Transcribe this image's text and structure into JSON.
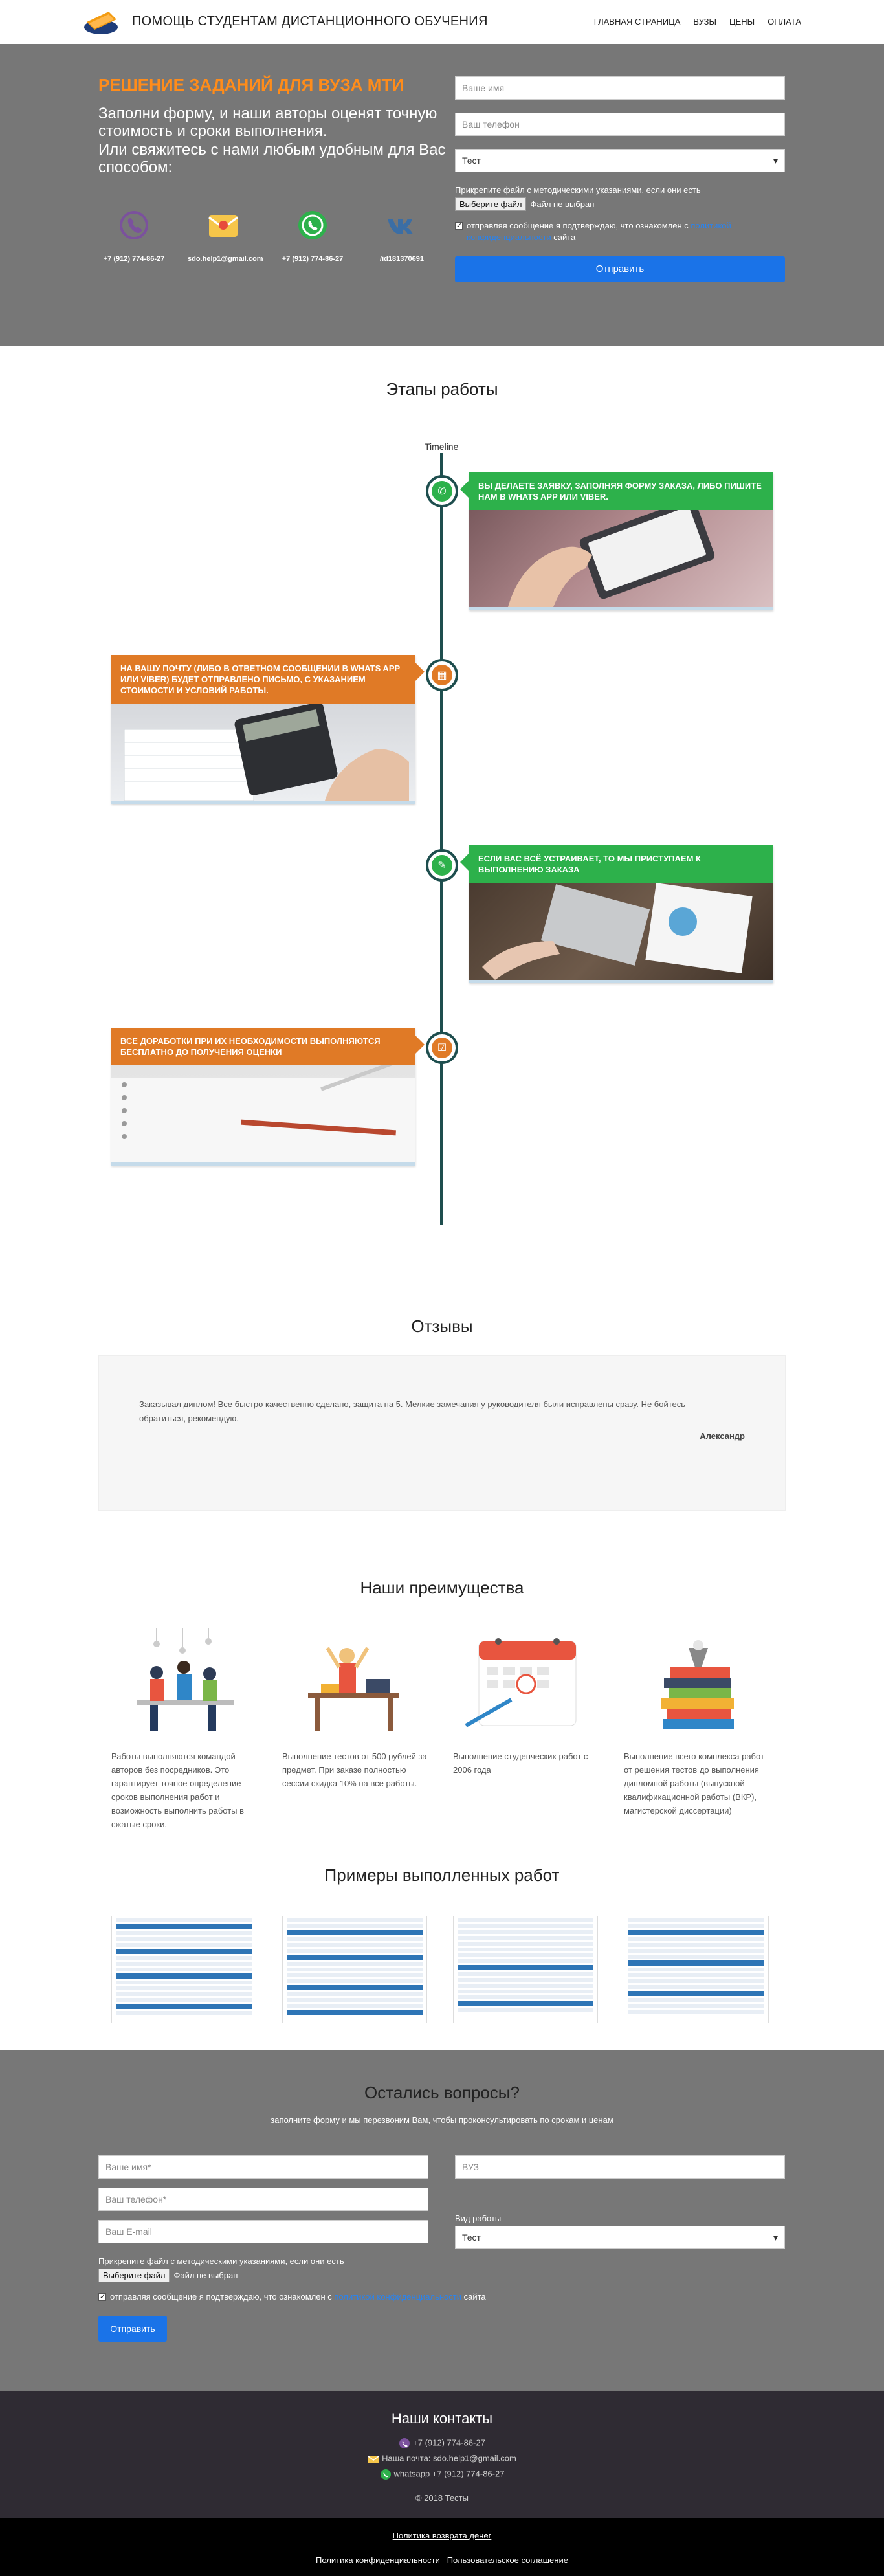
{
  "header": {
    "site_title": "ПОМОЩЬ СТУДЕНТАМ ДИСТАНЦИОННОГО ОБУЧЕНИЯ",
    "nav": [
      "ГЛАВНАЯ СТРАНИЦА",
      "ВУЗЫ",
      "ЦЕНЫ",
      "ОПЛАТА"
    ]
  },
  "hero": {
    "title": "РЕШЕНИЕ ЗАДАНИЙ ДЛЯ ВУЗА МТИ",
    "subtitle": "Заполни форму, и наши авторы оценят точную стоимость и сроки выполнения.",
    "subtitle2": "Или свяжитесь с нами любым удобным для Вас способом:",
    "contacts": [
      {
        "icon": "viber-icon",
        "label": "+7 (912) 774-86-27"
      },
      {
        "icon": "email-icon",
        "label": "sdo.help1@gmail.com"
      },
      {
        "icon": "whatsapp-icon",
        "label": "+7 (912) 774-86-27"
      },
      {
        "icon": "vk-icon",
        "label": "/id181370691"
      }
    ],
    "form": {
      "name_placeholder": "Ваше имя",
      "phone_placeholder": "Ваш телефон",
      "select_value": "Тест",
      "file_note": "Прикрепите файл с методическими указаниями, если они есть",
      "file_button": "Выберите файл",
      "file_status": "Файл не выбран",
      "agree_text": "отправляя сообщение я подтверждаю, что ознакомлен с",
      "agree_link": "политикой конфиденциальности",
      "agree_tail": "сайта",
      "submit": "Отправить"
    }
  },
  "stages": {
    "title": "Этапы работы",
    "timeline_label": "Timeline",
    "steps": [
      {
        "text": "ВЫ ДЕЛАЕТЕ ЗАЯВКУ, ЗАПОЛНЯЯ ФОРМУ ЗАКАЗА, ЛИБО ПИШИТЕ НАМ В WHATS APP ИЛИ VIBER.",
        "icon": "whatsapp-icon",
        "color": "#2db14b"
      },
      {
        "text": "НА ВАШУ ПОЧТУ (ЛИБО В ОТВЕТНОМ СООБЩЕНИИ В WHATS APP ИЛИ VIBER) БУДЕТ ОТПРАВЛЕНО ПИСЬМО, С УКАЗАНИЕМ СТОИМОСТИ И УСЛОВИЙ РАБОТЫ.",
        "icon": "calendar-icon",
        "color": "#e07a26"
      },
      {
        "text": "ЕСЛИ ВАС ВСЁ УСТРАИВАЕТ, ТО МЫ ПРИСТУПАЕМ К ВЫПОЛНЕНИЮ ЗАКАЗА",
        "icon": "edit-icon",
        "color": "#2db14b"
      },
      {
        "text": "ВСЕ ДОРАБОТКИ ПРИ ИХ НЕОБХОДИМОСТИ ВЫПОЛНЯЮТСЯ БЕСПЛАТНО ДО ПОЛУЧЕНИЯ ОЦЕНКИ",
        "icon": "checkbox-icon",
        "color": "#e07a26"
      }
    ]
  },
  "reviews": {
    "title": "Отзывы",
    "text": "Заказывал диплом! Все быстро качественно сделано, защита на 5. Мелкие замечания у руководителя были исправлены сразу. Не бойтесь обратиться, рекомендую.",
    "author": "Александр"
  },
  "advantages": {
    "title": "Наши преимущества",
    "items": [
      "Работы выполняются командой авторов без посредников. Это гарантирует точное определение сроков выполнения работ и возможность выполнить работы в сжатые сроки.",
      "Выполнение тестов от 500 рублей за предмет. При заказе полностью сессии скидка 10% на все работы.",
      "Выполнение студенческих работ с 2006 года",
      "Выполнение всего комплекса работ от решения тестов до выполнения дипломной работы (выпускной квалификационной работы (ВКР), магистерской диссертации)"
    ]
  },
  "examples": {
    "title": "Примеры выполленных работ"
  },
  "questions": {
    "title": "Остались вопросы?",
    "subtitle": "заполните форму и мы перезвоним Вам, чтобы проконсультировать по срокам и ценам",
    "name_placeholder": "Ваше имя*",
    "phone_placeholder": "Ваш телефон*",
    "email_placeholder": "Ваш E-mail",
    "vuz_placeholder": "ВУЗ",
    "type_label": "Вид работы",
    "type_value": "Тест",
    "file_note": "Прикрепите файл с методическими указаниями, если они есть",
    "file_button": "Выберите файл",
    "file_status": "Файл не выбран",
    "agree_text": "отправляя сообщение я подтверждаю, что ознакомлен с",
    "agree_link": "политикой конфиденциальности",
    "agree_tail": "сайта",
    "submit": "Отправить"
  },
  "contacts": {
    "title": "Наши контакты",
    "viber": "+7 (912) 774-86-27",
    "email": "Наша почта: sdo.help1@gmail.com",
    "whatsapp": "whatsapp +7 (912) 774-86-27",
    "copyright": "© 2018 Тесты"
  },
  "footer": {
    "refund": "Политика возврата денег",
    "privacy": "Политика конфиденциальности",
    "terms": "Пользовательское соглашение"
  }
}
